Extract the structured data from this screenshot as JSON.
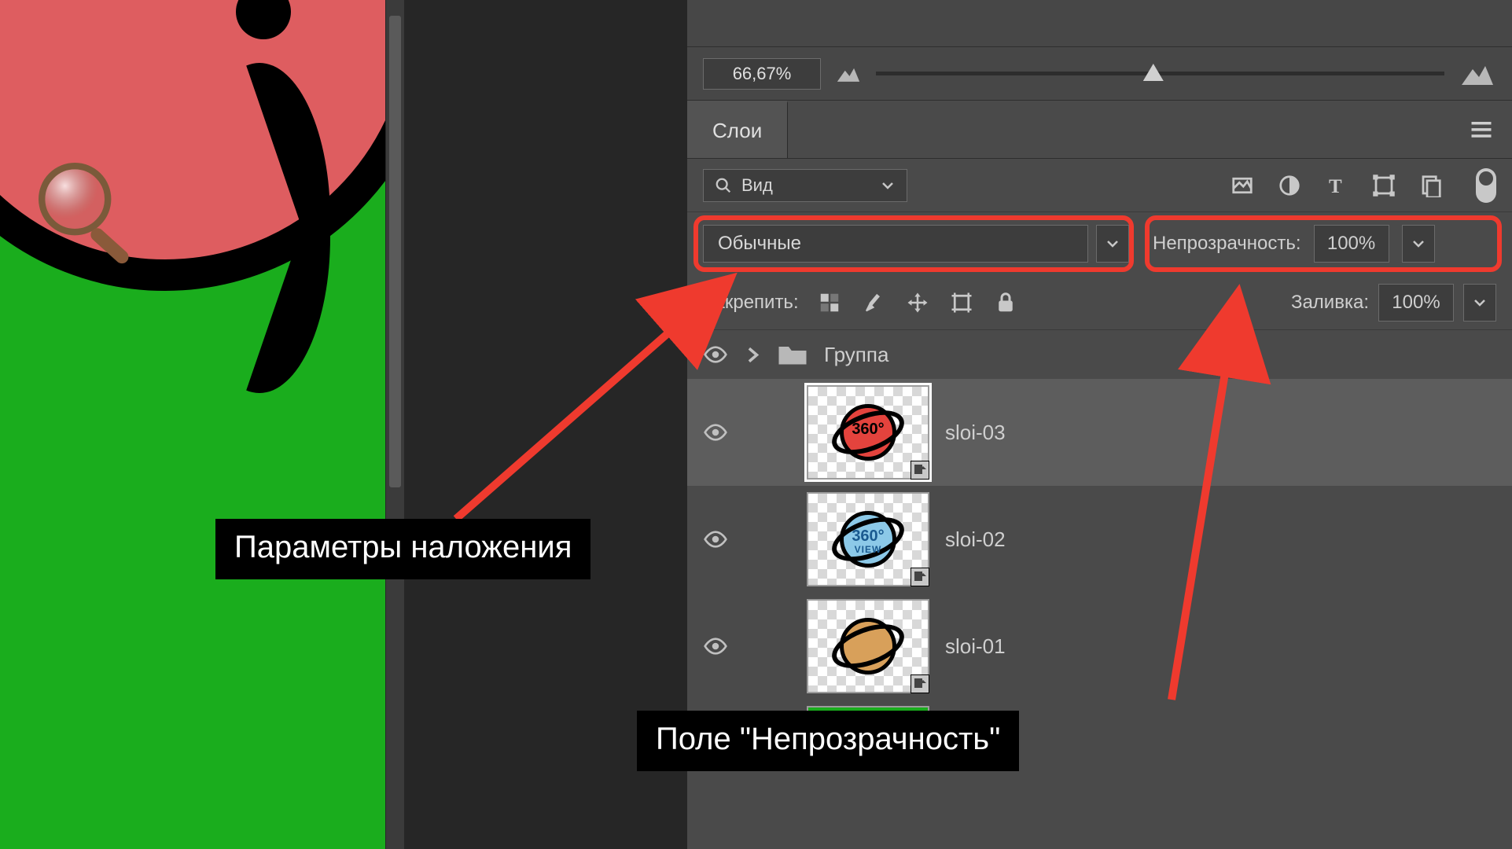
{
  "colors": {
    "highlight": "#ef3a2e",
    "canvas_green": "#1aad1d",
    "blob_pink": "#de5d60"
  },
  "navigator": {
    "zoom": "66,67%"
  },
  "panel": {
    "tab_label": "Слои",
    "filter_label": "Вид",
    "blend_mode": "Обычные",
    "opacity_label": "Непрозрачность:",
    "opacity_value": "100%",
    "lock_label": "Закрепить:",
    "fill_label": "Заливка:",
    "fill_value": "100%",
    "group_name": "Группа",
    "layers": [
      {
        "name": "sloi-03"
      },
      {
        "name": "sloi-02"
      },
      {
        "name": "sloi-01"
      }
    ]
  },
  "annotations": {
    "blend_label": "Параметры наложения",
    "opacity_label": "Поле \"Непрозрачность\""
  }
}
